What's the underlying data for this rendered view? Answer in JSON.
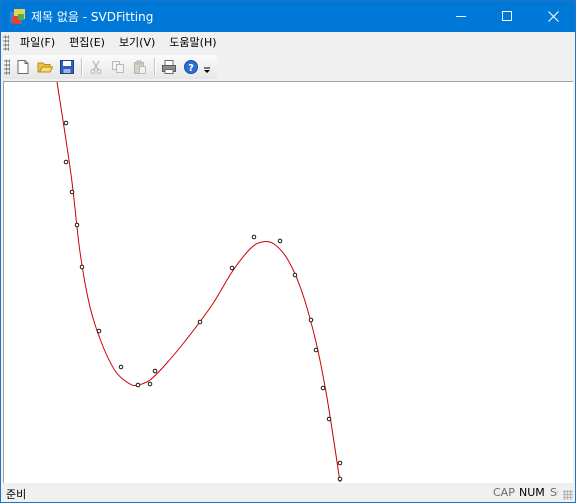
{
  "window": {
    "title": "제목 없음 - SVDFitting",
    "app_icon": "mfc-app-icon",
    "caption_buttons": [
      "minimize-icon",
      "maximize-icon",
      "close-icon"
    ]
  },
  "menubar": {
    "items": [
      {
        "label": "파일(F)"
      },
      {
        "label": "편집(E)"
      },
      {
        "label": "보기(V)"
      },
      {
        "label": "도움말(H)"
      }
    ]
  },
  "toolbar": {
    "buttons": [
      {
        "icon": "new-file-icon",
        "enabled": true
      },
      {
        "icon": "open-folder-icon",
        "enabled": true
      },
      {
        "icon": "save-icon",
        "enabled": true
      },
      {
        "icon": "cut-icon",
        "enabled": false
      },
      {
        "icon": "copy-icon",
        "enabled": false
      },
      {
        "icon": "paste-icon",
        "enabled": false
      },
      {
        "icon": "print-icon",
        "enabled": true
      },
      {
        "icon": "help-icon",
        "enabled": true
      },
      {
        "icon": "toolbar-overflow-icon",
        "enabled": true
      }
    ]
  },
  "plot": {
    "curve_color": "#cc0000",
    "point_color": "#000000"
  },
  "statusbar": {
    "text": "준비",
    "indicators": [
      {
        "label": "CAP",
        "active": false
      },
      {
        "label": "NUM",
        "active": true
      },
      {
        "label": "SCRL",
        "active": false
      }
    ]
  },
  "colors": {
    "titlebar": "#0078d7",
    "title_text": "#ffffff"
  }
}
